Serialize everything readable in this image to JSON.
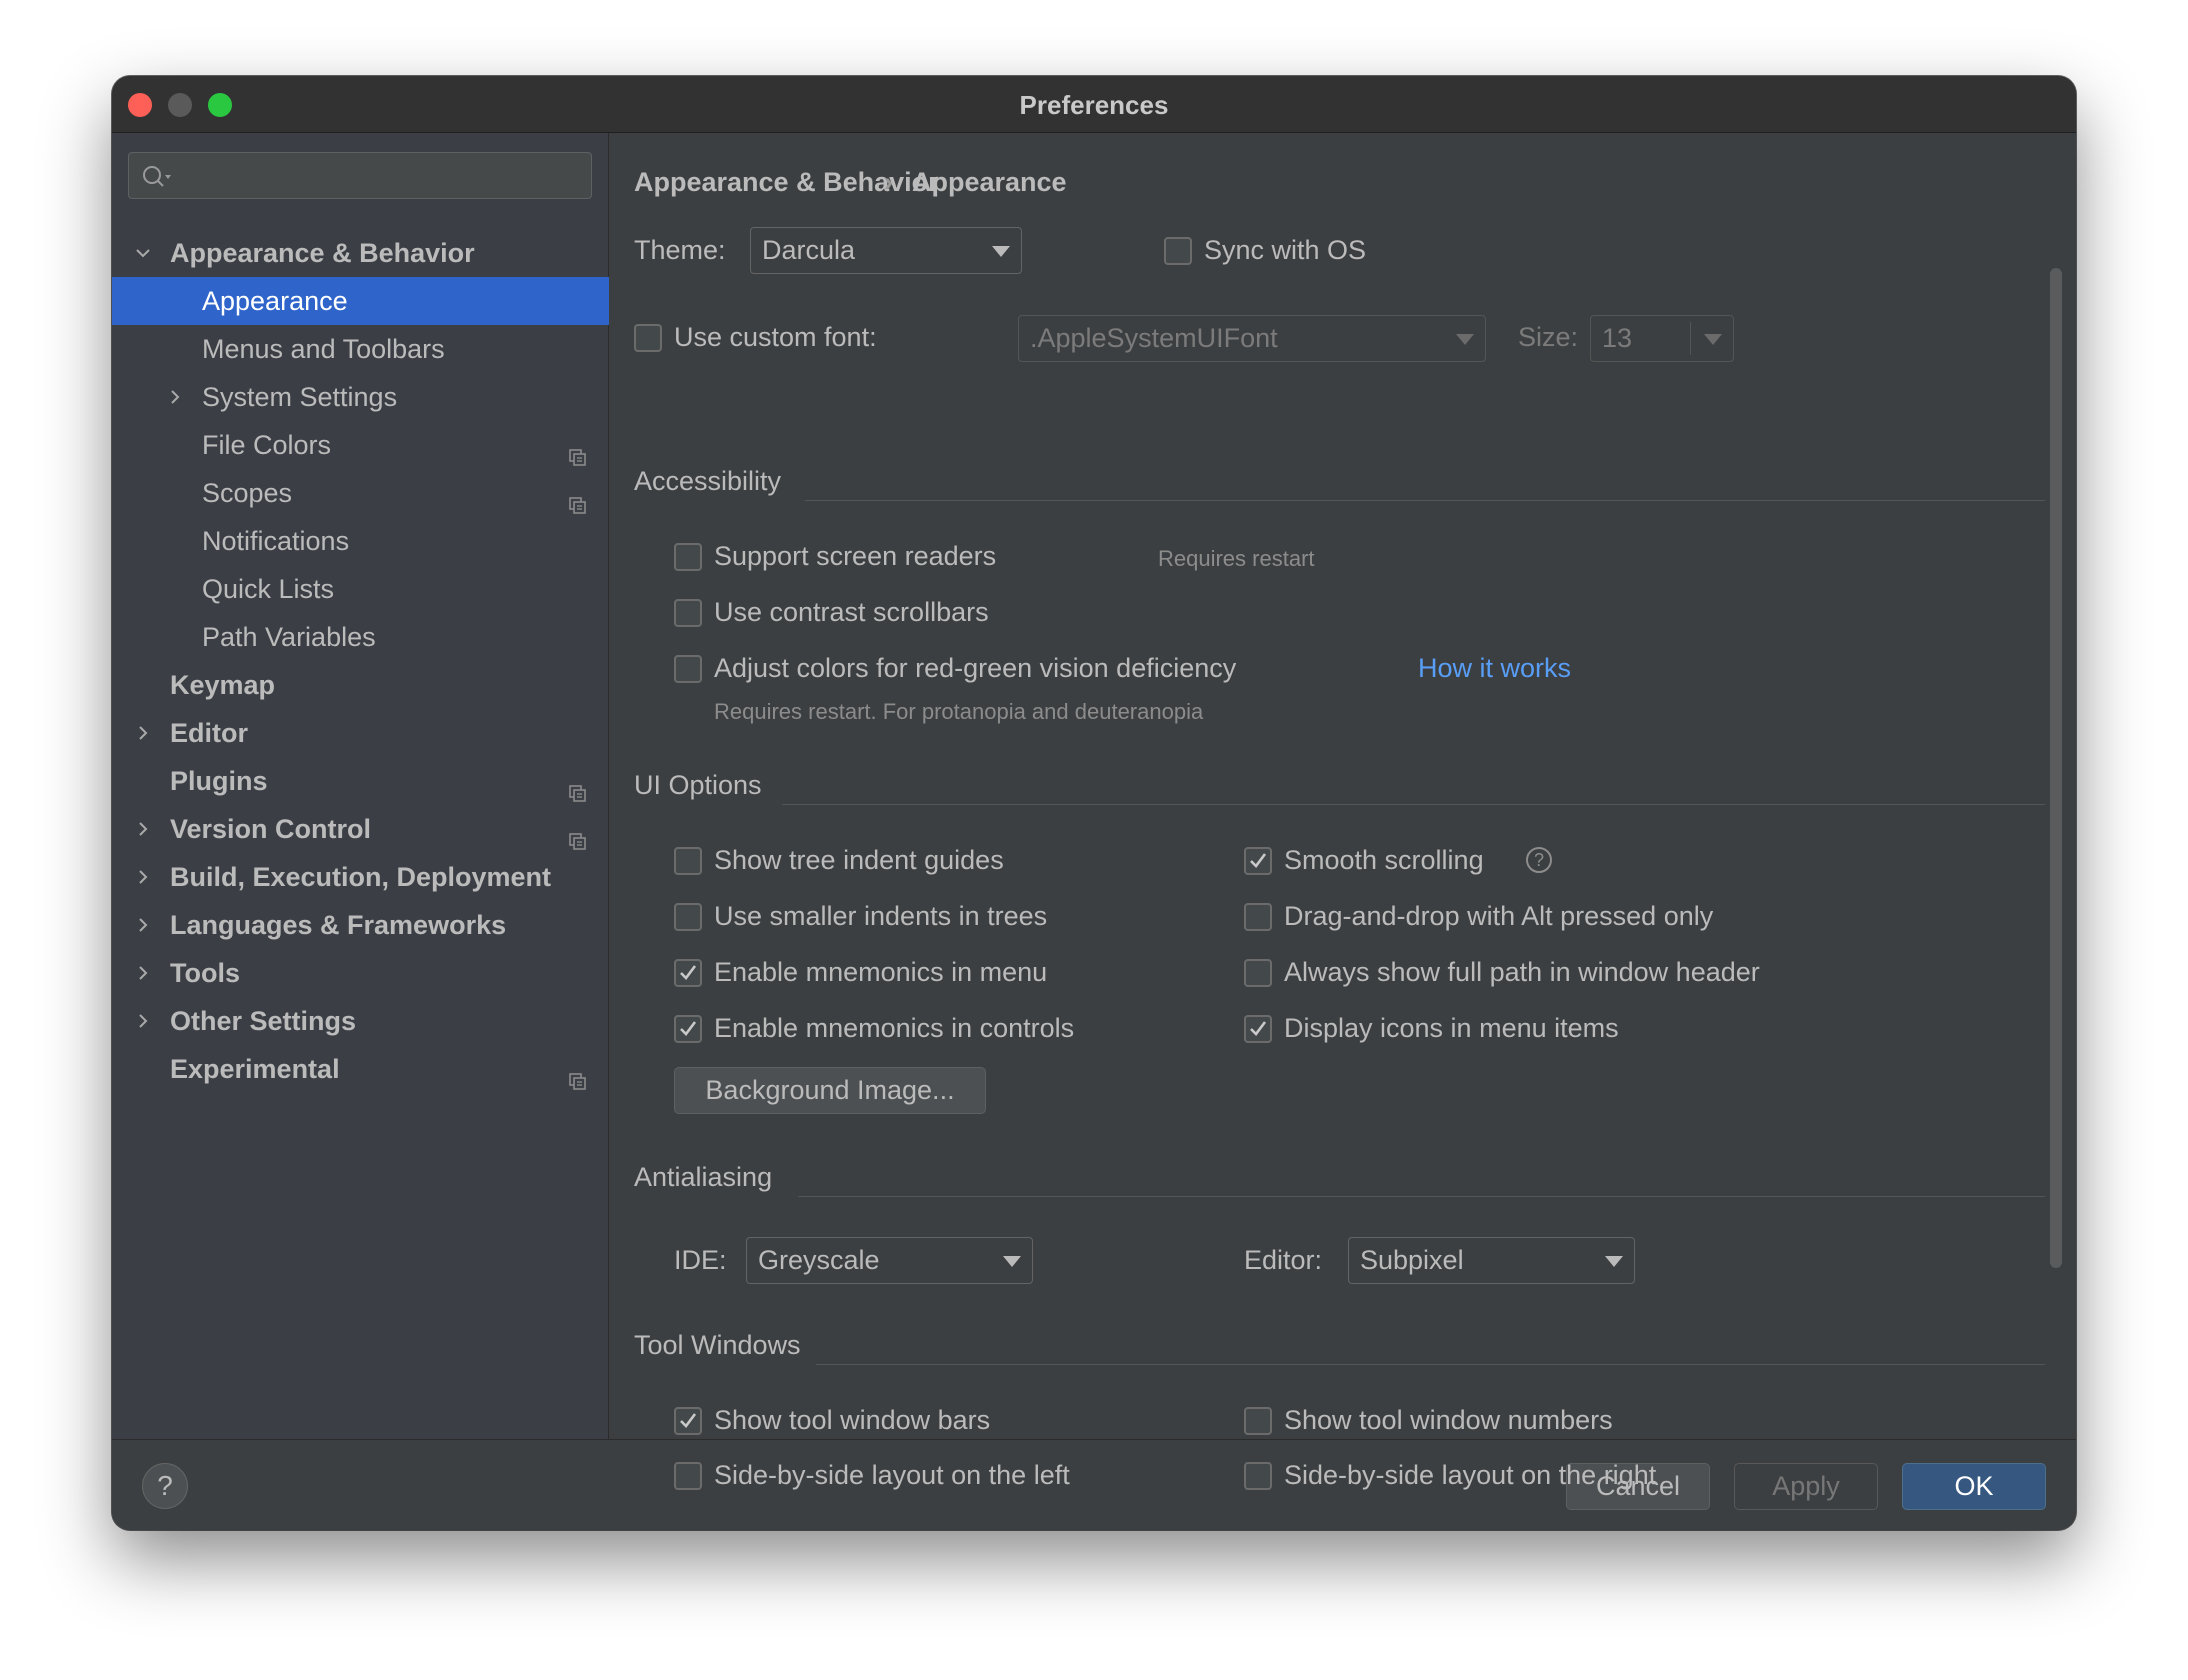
{
  "window": {
    "title": "Preferences"
  },
  "search": {
    "placeholder": ""
  },
  "sidebar": {
    "items": [
      {
        "label": "Appearance & Behavior"
      },
      {
        "label": "Appearance"
      },
      {
        "label": "Menus and Toolbars"
      },
      {
        "label": "System Settings"
      },
      {
        "label": "File Colors"
      },
      {
        "label": "Scopes"
      },
      {
        "label": "Notifications"
      },
      {
        "label": "Quick Lists"
      },
      {
        "label": "Path Variables"
      },
      {
        "label": "Keymap"
      },
      {
        "label": "Editor"
      },
      {
        "label": "Plugins"
      },
      {
        "label": "Version Control"
      },
      {
        "label": "Build, Execution, Deployment"
      },
      {
        "label": "Languages & Frameworks"
      },
      {
        "label": "Tools"
      },
      {
        "label": "Other Settings"
      },
      {
        "label": "Experimental"
      }
    ]
  },
  "breadcrumb": {
    "parent": "Appearance & Behavior",
    "separator": "›",
    "current": "Appearance"
  },
  "theme": {
    "label": "Theme:",
    "value": "Darcula",
    "sync_label": "Sync with OS",
    "sync_checked": false
  },
  "font": {
    "label": "Use custom font:",
    "checked": false,
    "value": ".AppleSystemUIFont",
    "size_label": "Size:",
    "size_value": "13"
  },
  "accessibility": {
    "title": "Accessibility",
    "screen_readers": {
      "label": "Support screen readers",
      "hint": "Requires restart",
      "checked": false
    },
    "contrast_scrollbars": {
      "label": "Use contrast scrollbars",
      "checked": false
    },
    "red_green": {
      "label": "Adjust colors for red-green vision deficiency",
      "link": "How it works",
      "hint": "Requires restart. For protanopia and deuteranopia",
      "checked": false
    }
  },
  "ui_options": {
    "title": "UI Options",
    "tree_indent_guides": {
      "label": "Show tree indent guides",
      "checked": false
    },
    "smaller_indents": {
      "label": "Use smaller indents in trees",
      "checked": false
    },
    "mnemonics_menu": {
      "label": "Enable mnemonics in menu",
      "checked": true
    },
    "mnemonics_controls": {
      "label": "Enable mnemonics in controls",
      "checked": true
    },
    "smooth_scrolling": {
      "label": "Smooth scrolling",
      "checked": true,
      "help": "?"
    },
    "drag_drop_alt": {
      "label": "Drag-and-drop with Alt pressed only",
      "checked": false
    },
    "full_path_header": {
      "label": "Always show full path in window header",
      "checked": false
    },
    "icons_in_menu": {
      "label": "Display icons in menu items",
      "checked": true
    },
    "background_image_button": "Background Image..."
  },
  "antialiasing": {
    "title": "Antialiasing",
    "ide_label": "IDE:",
    "ide_value": "Greyscale",
    "editor_label": "Editor:",
    "editor_value": "Subpixel"
  },
  "tool_windows": {
    "title": "Tool Windows",
    "show_bars": {
      "label": "Show tool window bars",
      "checked": true
    },
    "show_numbers": {
      "label": "Show tool window numbers",
      "checked": false
    },
    "side_left": {
      "label": "Side-by-side layout on the left",
      "checked": false
    },
    "side_right": {
      "label": "Side-by-side layout on the right",
      "checked": false
    }
  },
  "footer": {
    "help": "?",
    "cancel": "Cancel",
    "apply": "Apply",
    "ok": "OK"
  },
  "colors": {
    "selection": "#2f65ca",
    "link": "#589df6",
    "primary_button": "#365880",
    "background": "#3c3f41"
  }
}
